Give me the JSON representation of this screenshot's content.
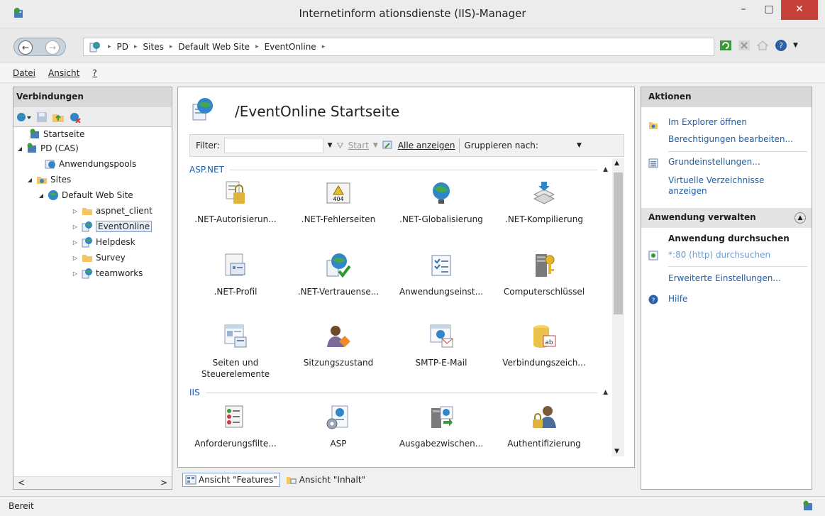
{
  "window": {
    "title": "Internetinform ationsdienste (IIS)-Manager",
    "min_glyph": "–",
    "max_glyph": "□",
    "close_glyph": "✕"
  },
  "address": {
    "back_glyph": "←",
    "forward_glyph": "→",
    "crumbs": [
      "PD",
      "Sites",
      "Default Web Site",
      "EventOnline"
    ],
    "sep": "▸"
  },
  "menu": {
    "items": [
      "Datei",
      "Ansicht",
      "?"
    ]
  },
  "connections": {
    "title": "Verbindungen",
    "tree": [
      {
        "label": "Startseite",
        "exp": ""
      },
      {
        "label": "PD (CAS)",
        "exp": "◢"
      },
      {
        "label": "Anwendungspools",
        "exp": ""
      },
      {
        "label": "Sites",
        "exp": "◢"
      },
      {
        "label": "Default Web Site",
        "exp": "◢"
      },
      {
        "label": "aspnet_client",
        "exp": "▷"
      },
      {
        "label": "EventOnline",
        "exp": "▷"
      },
      {
        "label": "Helpdesk",
        "exp": "▷"
      },
      {
        "label": "Survey",
        "exp": "▷"
      },
      {
        "label": "teamworks",
        "exp": "▷"
      }
    ],
    "scroll_left": "<",
    "scroll_right": ">"
  },
  "main": {
    "title": "/EventOnline Startseite",
    "filter_label": "Filter:",
    "start_label": "Start",
    "show_all_label": "Alle anzeigen",
    "group_by_label": "Gruppieren nach:",
    "groups": [
      {
        "name": "ASP.NET",
        "caret": "▲"
      },
      {
        "name": "IIS",
        "caret": "▲"
      }
    ],
    "features": [
      ".NET-Autorisierun...",
      ".NET-Fehlerseiten",
      ".NET-Globalisierung",
      ".NET-Kompilierung",
      ".NET-Profil",
      ".NET-Vertrauense...",
      "Anwendungseinst...",
      "Computerschlüssel",
      "Seiten und Steuerelemente",
      "Sitzungszustand",
      "SMTP-E-Mail",
      "Verbindungszeich...",
      "Anforderungsfilte...",
      "ASP",
      "Ausgabezwischen...",
      "Authentifizierung"
    ],
    "icon_404": "404"
  },
  "viewbar": {
    "features_view": "Ansicht \"Features\"",
    "content_view": "Ansicht \"Inhalt\""
  },
  "actions": {
    "title": "Aktionen",
    "explore": "Im Explorer öffnen",
    "permissions": "Berechtigungen bearbeiten...",
    "basic_settings": "Grundeinstellungen...",
    "virtual_dirs": "Virtuelle Verzeichnisse anzeigen",
    "manage_app": "Anwendung verwalten",
    "browse_app": "Anwendung durchsuchen",
    "browse_http": "*:80 (http) durchsuchen",
    "advanced": "Erweiterte Einstellungen...",
    "help": "Hilfe"
  },
  "status": {
    "text": "Bereit"
  },
  "colors": {
    "link": "#1e5ea8",
    "close": "#c7413b"
  }
}
